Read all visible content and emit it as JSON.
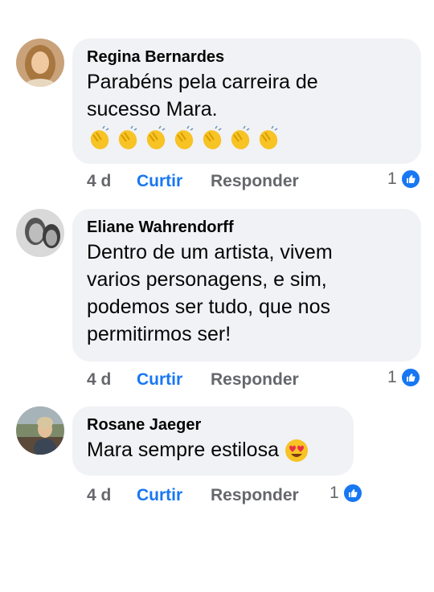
{
  "comments": [
    {
      "author": "Regina Bernardes",
      "line1": "Parabéns pela carreira de",
      "line2": "sucesso  Mara.",
      "emoji": "clapping-hands x7",
      "age": "4 d",
      "like_label": "Curtir",
      "reply_label": "Responder",
      "reaction_count": "1"
    },
    {
      "author": "Eliane Wahrendorff",
      "line1": "Dentro de um artista, vivem",
      "line2": "varios personagens, e sim,",
      "line3": "podemos ser tudo, que nos",
      "line4": "permitirmos ser!",
      "age": "4 d",
      "like_label": "Curtir",
      "reply_label": "Responder",
      "reaction_count": "1"
    },
    {
      "author": "Rosane Jaeger",
      "line1": "Mara sempre estilosa",
      "emoji": "heart-eyes",
      "age": "4 d",
      "like_label": "Curtir",
      "reply_label": "Responder",
      "reaction_count": "1"
    }
  ],
  "colors": {
    "bubble": "#f0f2f5",
    "link": "#1877f2",
    "muted": "#65676b"
  }
}
